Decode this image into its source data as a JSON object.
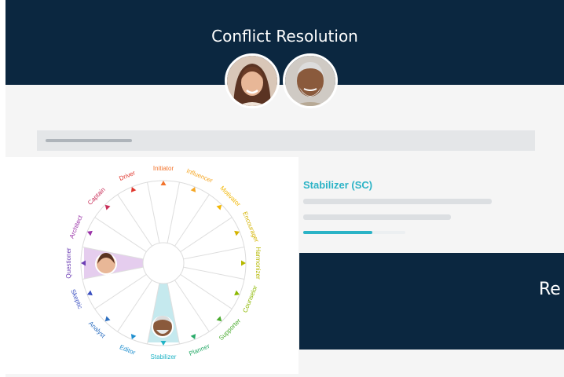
{
  "header": {
    "title": "Conflict Resolution"
  },
  "wheel": {
    "segments": [
      {
        "label": "Initiator",
        "color": "#f2742d"
      },
      {
        "label": "Influencer",
        "color": "#f5a623"
      },
      {
        "label": "Motivator",
        "color": "#f2b705"
      },
      {
        "label": "Encourager",
        "color": "#d4b300"
      },
      {
        "label": "Harmonizer",
        "color": "#b5b800"
      },
      {
        "label": "Counselor",
        "color": "#8cb800"
      },
      {
        "label": "Supporter",
        "color": "#4aab2e"
      },
      {
        "label": "Planner",
        "color": "#2aab6a"
      },
      {
        "label": "Stabilizer",
        "color": "#22b4c6"
      },
      {
        "label": "Editor",
        "color": "#1f8fcf"
      },
      {
        "label": "Analyst",
        "color": "#2d6fc0"
      },
      {
        "label": "Skeptic",
        "color": "#3a4fc0"
      },
      {
        "label": "Questioner",
        "color": "#6d3fb4"
      },
      {
        "label": "Architect",
        "color": "#9a33a8"
      },
      {
        "label": "Captain",
        "color": "#c9305a"
      },
      {
        "label": "Driver",
        "color": "#e0362c"
      }
    ],
    "highlighted": [
      "Questioner",
      "Stabilizer"
    ],
    "colors": {
      "questioner_wedge": "#e2c8ec",
      "stabilizer_wedge": "#bfe7ec"
    }
  },
  "result": {
    "style_title": "Stabilizer (SC)",
    "score_fraction": 0.68
  },
  "overlay": {
    "partial_text": "Re"
  },
  "colors": {
    "navy": "#0b2740",
    "teal": "#2bb3c6"
  }
}
